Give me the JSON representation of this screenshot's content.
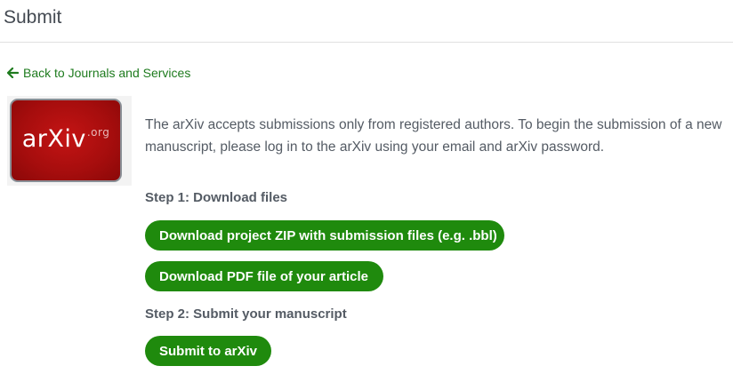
{
  "header": {
    "title": "Submit"
  },
  "back_link": {
    "label": "Back to Journals and Services",
    "icon": "arrow-left-icon"
  },
  "logo": {
    "text": "arXiv",
    "suffix": ".org"
  },
  "intro": {
    "text": "The arXiv accepts submissions only from registered authors. To begin the submission of a new manuscript, please log in to the arXiv using your email and arXiv password."
  },
  "step1": {
    "heading": "Step 1: Download files",
    "download_zip_label": "Download project ZIP with submission files (e.g. .bbl)",
    "download_pdf_label": "Download PDF file of your article"
  },
  "step2": {
    "heading": "Step 2: Submit your manuscript",
    "submit_label": "Submit to arXiv"
  },
  "colors": {
    "accent": "#1f8a0d",
    "link": "#1e7b1e",
    "logo_red": "#b01010"
  }
}
